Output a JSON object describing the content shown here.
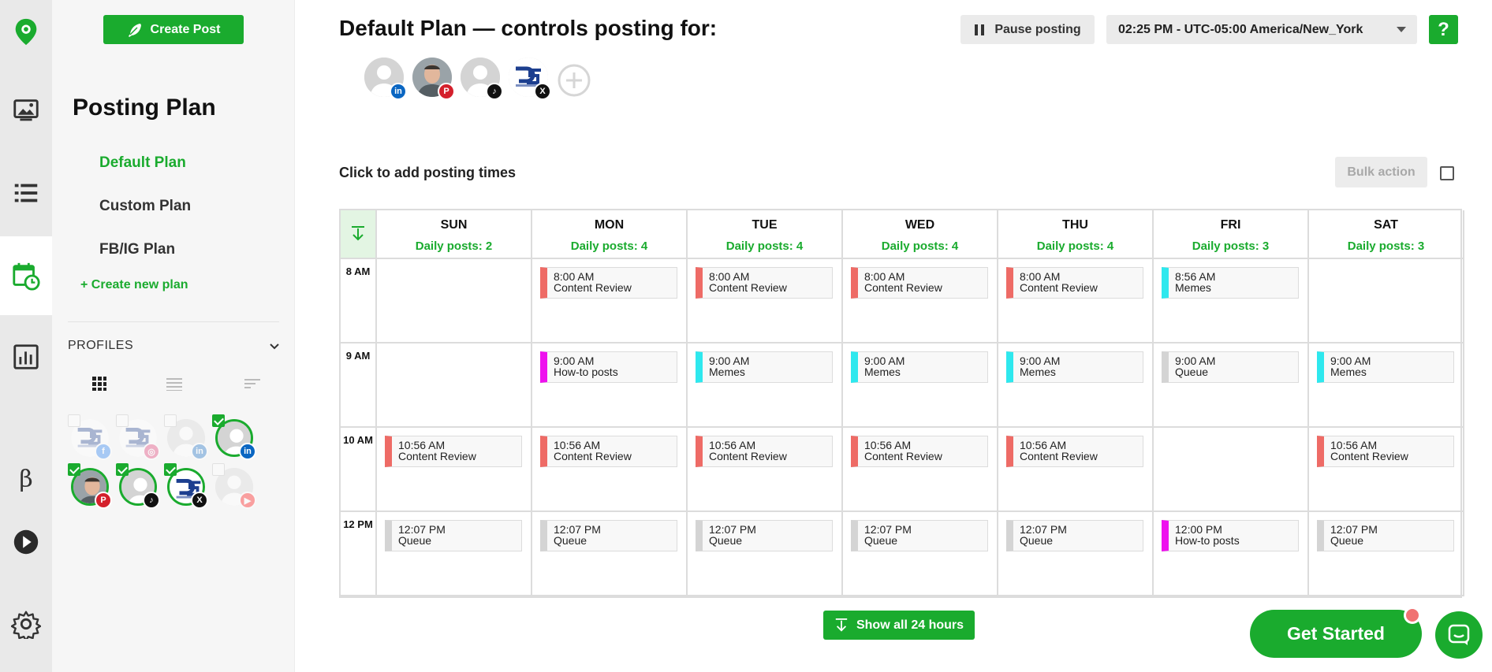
{
  "sidebar_rail": {
    "items": [
      {
        "name": "logo-pin-icon"
      },
      {
        "name": "media-library-icon"
      },
      {
        "name": "post-list-icon"
      },
      {
        "name": "calendar-clock-icon"
      },
      {
        "name": "analytics-icon"
      },
      {
        "name": "beta-icon",
        "glyph": "β"
      },
      {
        "name": "play-icon"
      },
      {
        "name": "settings-gear-icon"
      }
    ]
  },
  "panel": {
    "create_post_label": "Create Post",
    "title": "Posting Plan",
    "plans": [
      "Default Plan",
      "Custom Plan",
      "FB/IG Plan"
    ],
    "active_plan": "Default Plan",
    "create_plan_label": "+ Create new plan",
    "profiles_label": "PROFILES",
    "profiles": [
      {
        "kind": "brand",
        "network": "facebook",
        "selected": false
      },
      {
        "kind": "brand",
        "network": "instagram",
        "selected": false
      },
      {
        "kind": "person",
        "network": "linkedin",
        "selected": false
      },
      {
        "kind": "person",
        "network": "linkedin",
        "selected": true
      },
      {
        "kind": "photo",
        "network": "pinterest",
        "selected": true
      },
      {
        "kind": "person",
        "network": "tiktok",
        "selected": true
      },
      {
        "kind": "brand",
        "network": "x",
        "selected": true
      },
      {
        "kind": "person",
        "network": "youtube",
        "selected": false
      }
    ]
  },
  "header": {
    "title": "Default Plan — controls posting for:",
    "pause_label": "Pause posting",
    "timezone": "02:25 PM - UTC-05:00 America/New_York",
    "help_label": "?"
  },
  "plan_profiles": [
    {
      "kind": "person",
      "network": "linkedin"
    },
    {
      "kind": "photo",
      "network": "pinterest"
    },
    {
      "kind": "person",
      "network": "tiktok"
    },
    {
      "kind": "brand",
      "network": "x"
    }
  ],
  "calendar": {
    "hint": "Click to add posting times",
    "bulk_action_label": "Bulk action",
    "days": [
      {
        "name": "SUN",
        "posts": "Daily posts: 2"
      },
      {
        "name": "MON",
        "posts": "Daily posts: 4"
      },
      {
        "name": "TUE",
        "posts": "Daily posts: 4"
      },
      {
        "name": "WED",
        "posts": "Daily posts: 4"
      },
      {
        "name": "THU",
        "posts": "Daily posts: 4"
      },
      {
        "name": "FRI",
        "posts": "Daily posts: 3"
      },
      {
        "name": "SAT",
        "posts": "Daily posts: 3"
      }
    ],
    "hours": [
      "8 AM",
      "9 AM",
      "10 AM",
      "12 PM"
    ],
    "slots": [
      [
        null,
        {
          "time": "8:00 AM",
          "name": "Content Review",
          "color": "#ee6b66"
        },
        {
          "time": "8:00 AM",
          "name": "Content Review",
          "color": "#ee6b66"
        },
        {
          "time": "8:00 AM",
          "name": "Content Review",
          "color": "#ee6b66"
        },
        {
          "time": "8:00 AM",
          "name": "Content Review",
          "color": "#ee6b66"
        },
        {
          "time": "8:56 AM",
          "name": "Memes",
          "color": "#2ee8ee"
        },
        null
      ],
      [
        null,
        {
          "time": "9:00 AM",
          "name": "How-to posts",
          "color": "#ee11ee"
        },
        {
          "time": "9:00 AM",
          "name": "Memes",
          "color": "#2ee8ee"
        },
        {
          "time": "9:00 AM",
          "name": "Memes",
          "color": "#2ee8ee"
        },
        {
          "time": "9:00 AM",
          "name": "Memes",
          "color": "#2ee8ee"
        },
        {
          "time": "9:00 AM",
          "name": "Queue",
          "color": "#d4d4d4"
        },
        {
          "time": "9:00 AM",
          "name": "Memes",
          "color": "#2ee8ee"
        }
      ],
      [
        {
          "time": "10:56 AM",
          "name": "Content Review",
          "color": "#ee6b66"
        },
        {
          "time": "10:56 AM",
          "name": "Content Review",
          "color": "#ee6b66"
        },
        {
          "time": "10:56 AM",
          "name": "Content Review",
          "color": "#ee6b66"
        },
        {
          "time": "10:56 AM",
          "name": "Content Review",
          "color": "#ee6b66"
        },
        {
          "time": "10:56 AM",
          "name": "Content Review",
          "color": "#ee6b66"
        },
        null,
        {
          "time": "10:56 AM",
          "name": "Content Review",
          "color": "#ee6b66"
        }
      ],
      [
        {
          "time": "12:07 PM",
          "name": "Queue",
          "color": "#d4d4d4"
        },
        {
          "time": "12:07 PM",
          "name": "Queue",
          "color": "#d4d4d4"
        },
        {
          "time": "12:07 PM",
          "name": "Queue",
          "color": "#d4d4d4"
        },
        {
          "time": "12:07 PM",
          "name": "Queue",
          "color": "#d4d4d4"
        },
        {
          "time": "12:07 PM",
          "name": "Queue",
          "color": "#d4d4d4"
        },
        {
          "time": "12:00 PM",
          "name": "How-to posts",
          "color": "#ee11ee"
        },
        {
          "time": "12:07 PM",
          "name": "Queue",
          "color": "#d4d4d4"
        }
      ]
    ],
    "show_all_label": "Show all 24 hours"
  },
  "footer": {
    "get_started_label": "Get Started"
  },
  "colors": {
    "accent": "#1aab2e",
    "network": {
      "linkedin": "#0a66c2",
      "pinterest": "#d4202c",
      "tiktok": "#111111",
      "x": "#111111",
      "facebook": "#1877f2",
      "instagram": "#e1306c",
      "youtube": "#ff0000"
    }
  }
}
